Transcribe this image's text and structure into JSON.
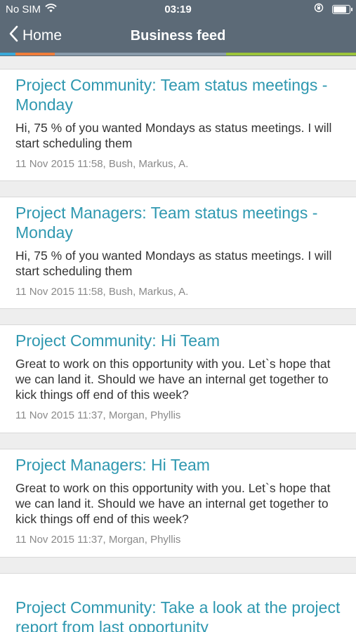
{
  "status_bar": {
    "carrier": "No SIM",
    "time": "03:19",
    "wifi_icon": "wifi-icon",
    "lock_icon": "orientation-lock-icon",
    "battery_icon": "battery-icon"
  },
  "nav": {
    "back_label": "Home",
    "title": "Business feed",
    "accent_colors": [
      "#3aa9d8",
      "#f07d3a",
      "#8a9bab",
      "#9cc43a"
    ]
  },
  "feed": [
    {
      "title": "Project Community: Team status meetings - Monday",
      "body": "Hi, 75 % of you wanted Mondays as status meetings. I will start scheduling them",
      "meta": "11 Nov 2015 11:58, Bush, Markus, A."
    },
    {
      "title": "Project Managers: Team status meetings - Monday",
      "body": "Hi, 75 % of you wanted Mondays as status meetings. I will start scheduling them",
      "meta": "11 Nov 2015 11:58, Bush, Markus, A."
    },
    {
      "title": "Project Community: Hi Team",
      "body": "Great to work on this opportunity with you. Let`s hope that we can land it. Should we have an internal get together to kick things off end of this week?",
      "meta": "11 Nov 2015 11:37, Morgan, Phyllis"
    },
    {
      "title": "Project Managers: Hi Team",
      "body": "Great to work on this opportunity with you. Let`s hope that we can land it. Should we have an internal get together to kick things off end of this week?",
      "meta": "11 Nov 2015 11:37, Morgan, Phyllis"
    },
    {
      "title": "Project Community: Take a look at the project report from last opportunity",
      "body": "",
      "meta": ""
    }
  ]
}
